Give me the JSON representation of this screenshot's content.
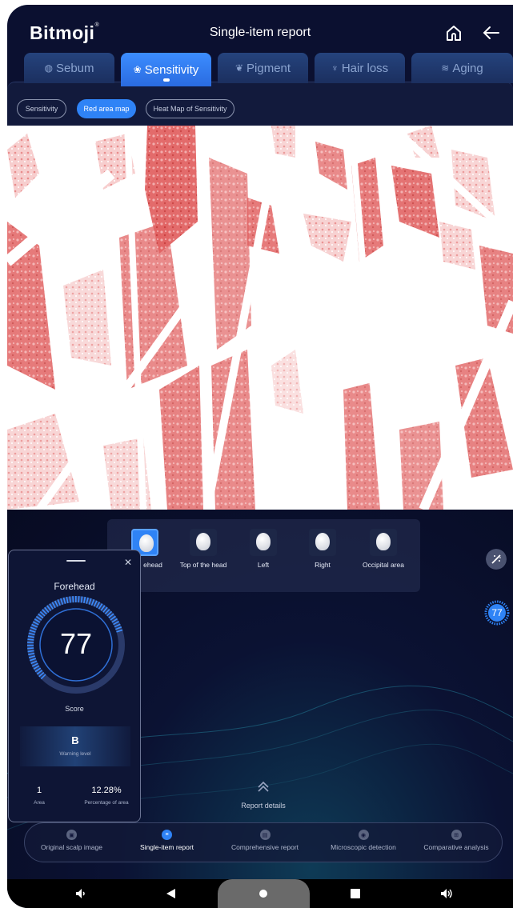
{
  "app": {
    "logo": "Bitmoji",
    "title": "Single-item report"
  },
  "tabs": [
    {
      "label": "Sebum",
      "icon": "globe-icon"
    },
    {
      "label": "Sensitivity",
      "icon": "flower-icon",
      "active": true
    },
    {
      "label": "Pigment",
      "icon": "pigment-icon"
    },
    {
      "label": "Hair loss",
      "icon": "hair-icon"
    },
    {
      "label": "Aging",
      "icon": "waves-icon"
    }
  ],
  "subtabs": [
    {
      "label": "Sensitivity"
    },
    {
      "label": "Red area map",
      "active": true
    },
    {
      "label": "Heat Map of Sensitivity"
    }
  ],
  "positions": [
    {
      "label": "Forehead",
      "visible_label": "ehead",
      "active": true
    },
    {
      "label": "Top of the head"
    },
    {
      "label": "Left"
    },
    {
      "label": "Right"
    },
    {
      "label": "Occipital area"
    }
  ],
  "card": {
    "region": "Forehead",
    "score": "77",
    "score_label": "Score",
    "warning_level": "B",
    "warning_label": "Warning level",
    "area_value": "1",
    "area_label": "Area",
    "pct_value": "12.28%",
    "pct_label": "Percentage of area"
  },
  "side": {
    "score_badge": "77"
  },
  "details_label": "Report details",
  "bottom_nav": [
    {
      "label": "Original scalp image"
    },
    {
      "label": "Single-item report",
      "active": true
    },
    {
      "label": "Comprehensive report"
    },
    {
      "label": "Microscopic detection"
    },
    {
      "label": "Comparative analysis"
    }
  ],
  "colors": {
    "accent": "#2f83f6",
    "background": "#0b1030",
    "redmap": "#d94b4b"
  }
}
